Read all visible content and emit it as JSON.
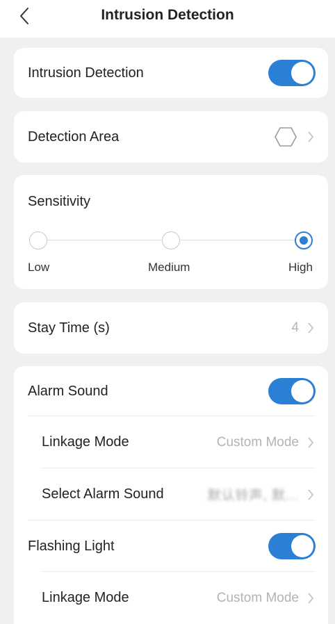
{
  "header": {
    "title": "Intrusion Detection"
  },
  "intrusion_detection": {
    "label": "Intrusion Detection",
    "enabled": true
  },
  "detection_area": {
    "label": "Detection Area"
  },
  "sensitivity": {
    "label": "Sensitivity",
    "options": [
      "Low",
      "Medium",
      "High"
    ],
    "selected": "High"
  },
  "stay_time": {
    "label": "Stay Time (s)",
    "value": "4"
  },
  "alarm_sound": {
    "label": "Alarm Sound",
    "enabled": true,
    "linkage_mode_label": "Linkage Mode",
    "linkage_mode_value": "Custom Mode",
    "select_sound_label": "Select Alarm Sound",
    "select_sound_value": "默认铃声, 默..."
  },
  "flashing_light": {
    "label": "Flashing Light",
    "enabled": true,
    "linkage_mode_label": "Linkage Mode",
    "linkage_mode_value": "Custom Mode"
  },
  "colors": {
    "accent": "#2b7fd4",
    "background": "#f0f0f3",
    "card": "#ffffff",
    "muted_text": "#b3b3b3"
  }
}
